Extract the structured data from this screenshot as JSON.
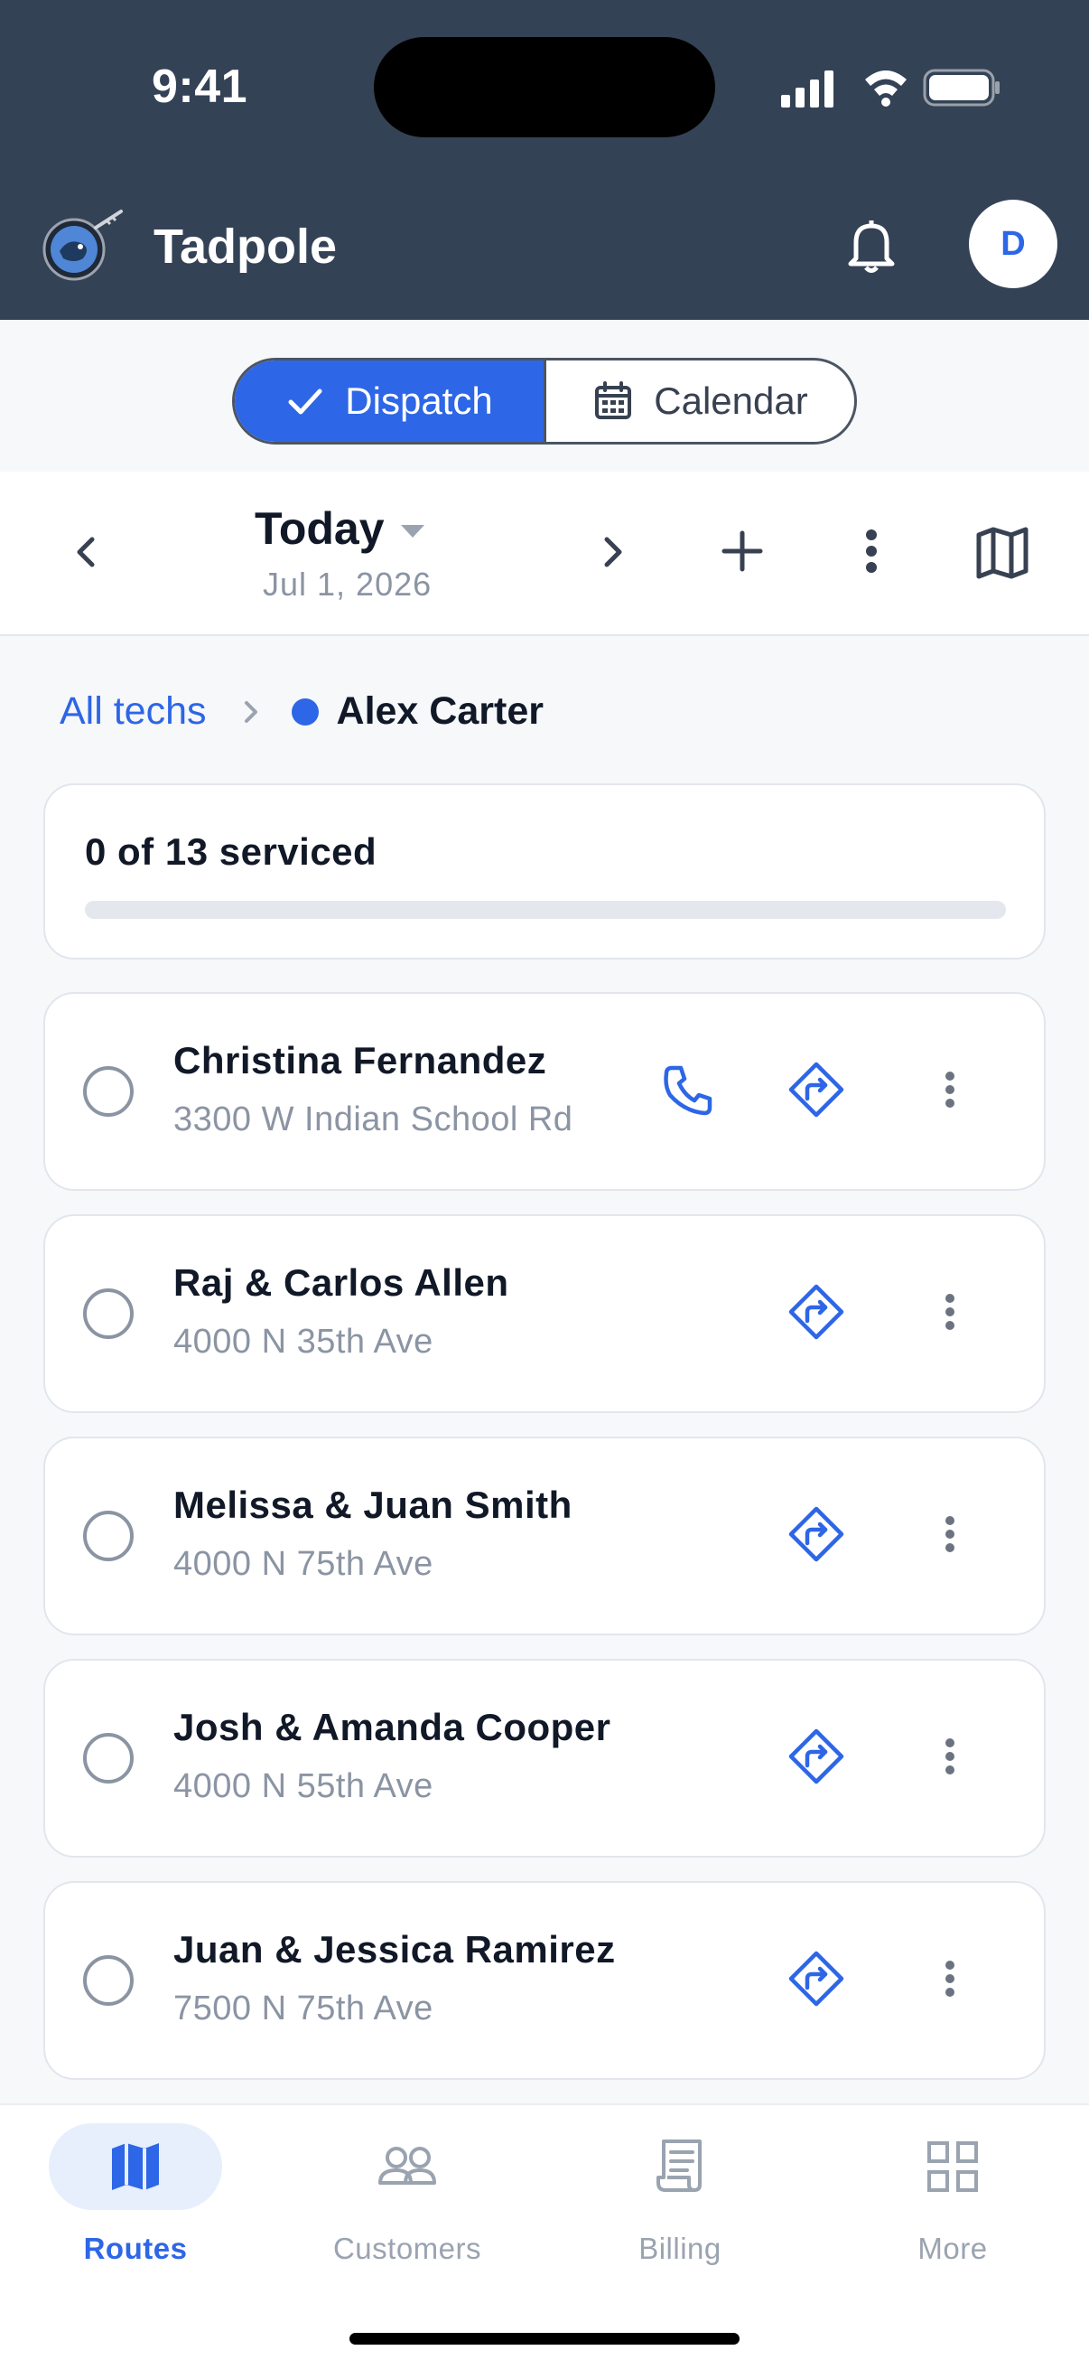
{
  "status_bar": {
    "time": "9:41"
  },
  "header": {
    "title": "Tadpole",
    "avatar_initial": "D"
  },
  "view_toggle": {
    "active_label": "Dispatch",
    "inactive_label": "Calendar"
  },
  "date_nav": {
    "title": "Today",
    "date": "Jul 1, 2026"
  },
  "breadcrumb": {
    "root": "All techs",
    "current": "Alex Carter",
    "tech_color": "#2d66e6"
  },
  "progress": {
    "label": "0 of 13 serviced",
    "serviced": 0,
    "total": 13
  },
  "stops": [
    {
      "name": "Christina Fernandez",
      "address": "3300 W Indian School Rd",
      "has_phone": true
    },
    {
      "name": "Raj & Carlos Allen",
      "address": "4000 N 35th Ave",
      "has_phone": false
    },
    {
      "name": "Melissa & Juan Smith",
      "address": "4000 N 75th Ave",
      "has_phone": false
    },
    {
      "name": "Josh & Amanda Cooper",
      "address": "4000 N 55th Ave",
      "has_phone": false
    },
    {
      "name": "Juan & Jessica Ramirez",
      "address": "7500 N 75th Ave",
      "has_phone": false
    }
  ],
  "tabbar": {
    "tabs": [
      {
        "label": "Routes",
        "icon": "map-icon",
        "active": true
      },
      {
        "label": "Customers",
        "icon": "users-icon",
        "active": false
      },
      {
        "label": "Billing",
        "icon": "receipt-icon",
        "active": false
      },
      {
        "label": "More",
        "icon": "grid-icon",
        "active": false
      }
    ]
  },
  "colors": {
    "header_bg": "#344256",
    "accent": "#2d66e6",
    "muted": "#8b94a3"
  }
}
